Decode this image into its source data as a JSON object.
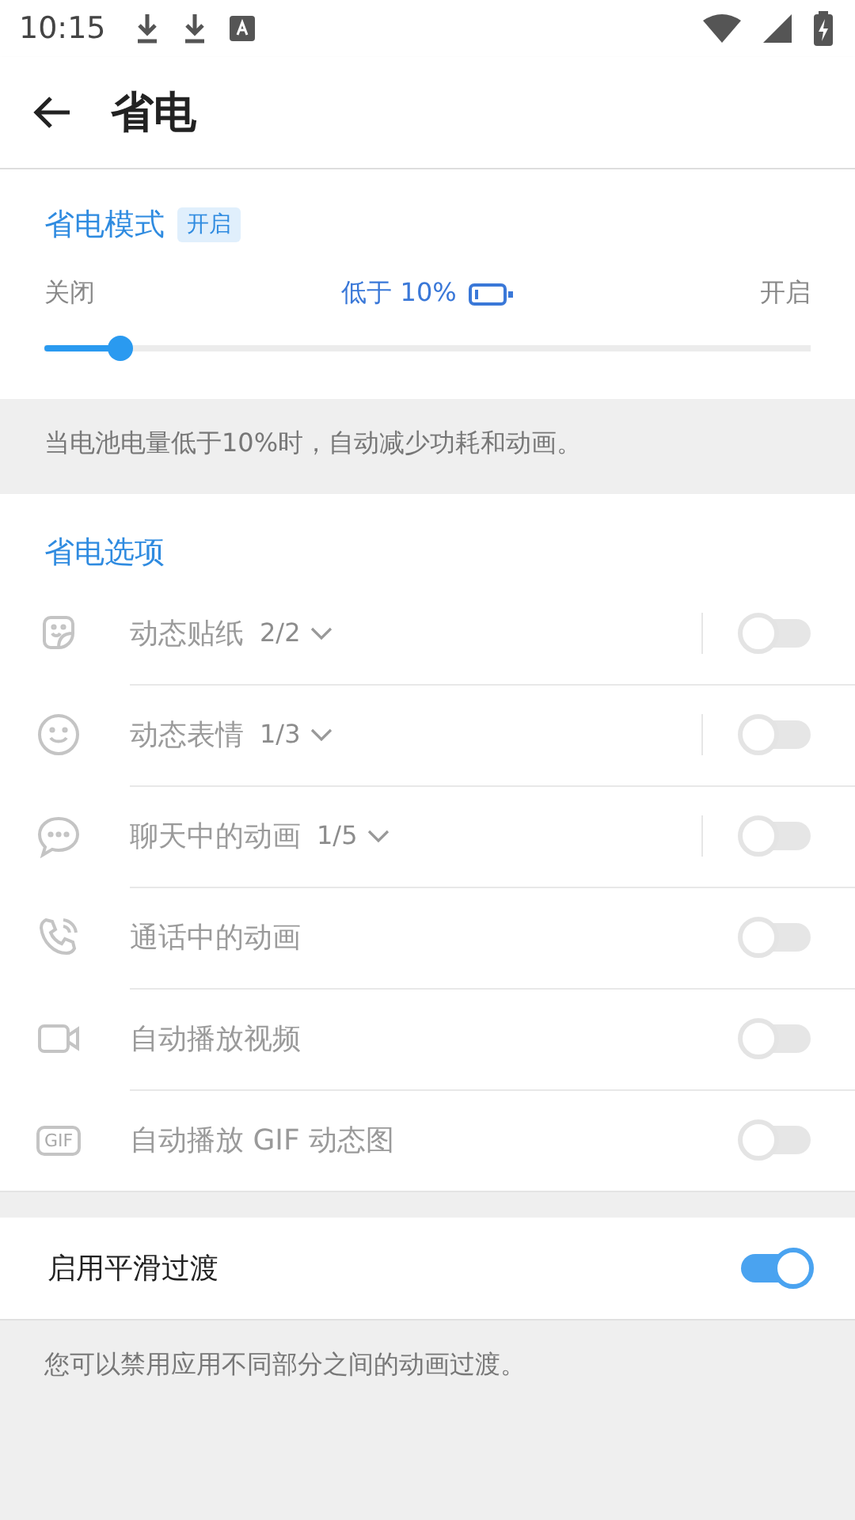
{
  "status_bar": {
    "time": "10:15"
  },
  "app_bar": {
    "title": "省电"
  },
  "power_mode": {
    "title": "省电模式",
    "badge": "开启",
    "left_label": "关闭",
    "threshold": "低于 10%",
    "right_label": "开启",
    "level": 0.1
  },
  "info": "当电池电量低于10%时，自动减少功耗和动画。",
  "options": {
    "title": "省电选项",
    "items": [
      {
        "kind": "sticker",
        "label": "动态贴纸",
        "count": "2/2",
        "dropdown": true,
        "on": false,
        "disabled": true
      },
      {
        "kind": "smile",
        "label": "动态表情",
        "count": "1/3",
        "dropdown": true,
        "on": false,
        "disabled": true
      },
      {
        "kind": "chat",
        "label": "聊天中的动画",
        "count": "1/5",
        "dropdown": true,
        "on": false,
        "disabled": true
      },
      {
        "kind": "call",
        "label": "通话中的动画",
        "on": false,
        "disabled": true
      },
      {
        "kind": "video",
        "label": "自动播放视频",
        "on": false,
        "disabled": true
      },
      {
        "kind": "gif",
        "icon_text": "GIF",
        "label": "自动播放 GIF 动态图",
        "on": false,
        "disabled": true
      }
    ]
  },
  "smooth": {
    "label": "启用平滑过渡",
    "on": true
  },
  "footer": "您可以禁用应用不同部分之间的动画过渡。"
}
